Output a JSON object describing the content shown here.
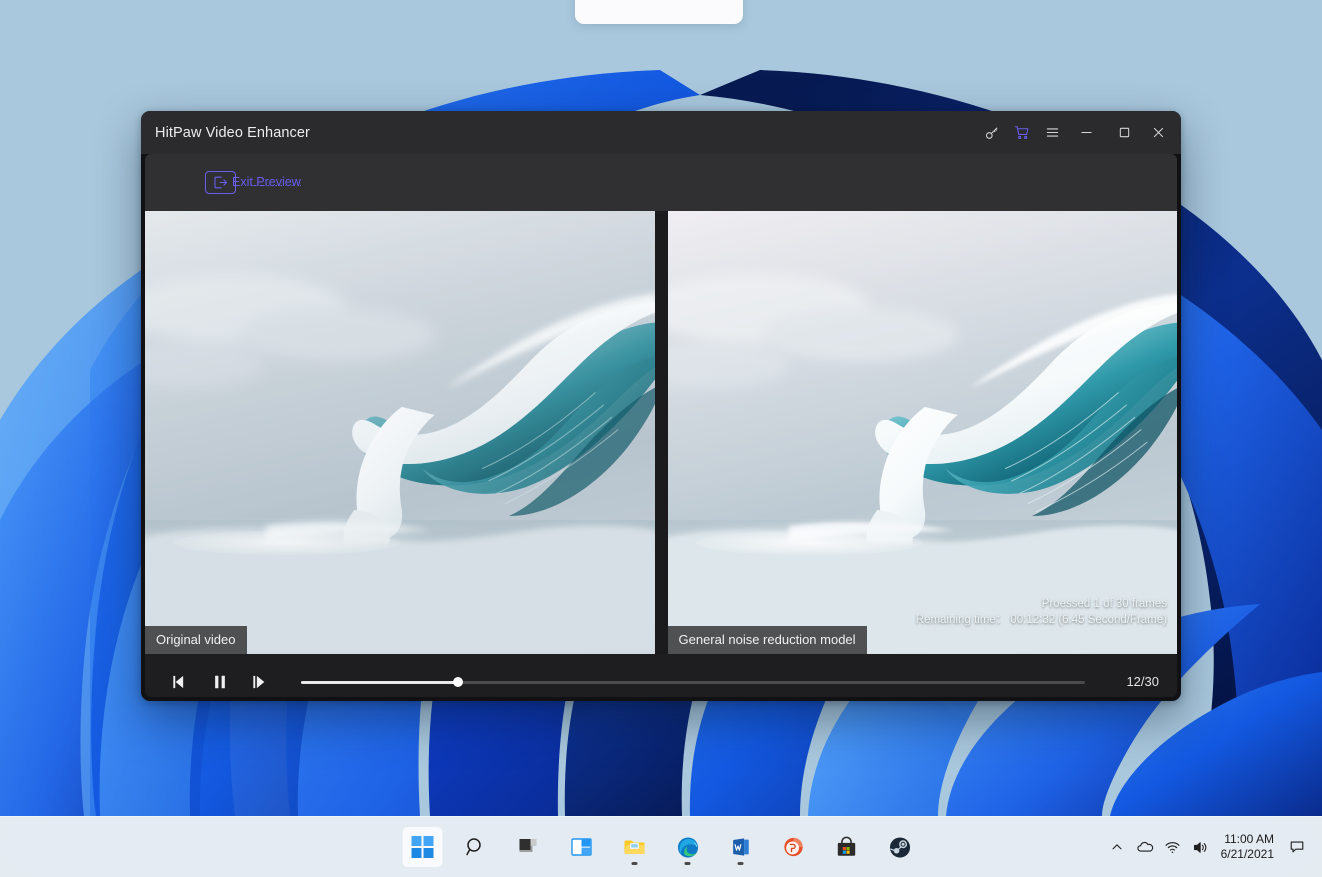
{
  "desktop": {
    "wallpaper_name": "windows-11-bloom-wallpaper",
    "background_color": "#a9c8dd"
  },
  "app": {
    "title": "HitPaw Video Enhancer",
    "titlebar_icons": [
      {
        "name": "key-icon",
        "glyph": "key"
      },
      {
        "name": "shopping-cart-icon",
        "glyph": "cart",
        "color": "#6a5df0"
      },
      {
        "name": "hamburger-menu-icon",
        "glyph": "menu"
      },
      {
        "name": "minimize-icon",
        "glyph": "minimize"
      },
      {
        "name": "maximize-icon",
        "glyph": "maximize"
      },
      {
        "name": "close-icon",
        "glyph": "close"
      }
    ],
    "toolbar": {
      "exit_preview_label": "Exit Preview",
      "accent_color": "#6a5df0"
    },
    "panes": {
      "left": {
        "label": "Original video"
      },
      "right": {
        "label": "General noise reduction model",
        "processed_text": "Proessed 1 of 30 frames",
        "remaining_text": "Remaining time： 00:12:32 (6.45 Second/Frame)"
      }
    },
    "player": {
      "prev_frame_label": "previous-frame",
      "pause_label": "pause",
      "next_frame_label": "next-frame",
      "frame_counter": "12/30",
      "progress_percent": 20
    }
  },
  "taskbar": {
    "items": [
      {
        "name": "start-button",
        "label": "Start",
        "active": true,
        "running": false
      },
      {
        "name": "search-button",
        "label": "Search",
        "active": false,
        "running": false
      },
      {
        "name": "task-view-button",
        "label": "Task View",
        "active": false,
        "running": false
      },
      {
        "name": "widgets-button",
        "label": "Widgets",
        "active": false,
        "running": false
      },
      {
        "name": "file-explorer-button",
        "label": "File Explorer",
        "active": false,
        "running": true
      },
      {
        "name": "edge-button",
        "label": "Microsoft Edge",
        "active": false,
        "running": true
      },
      {
        "name": "word-button",
        "label": "Word",
        "active": false,
        "running": true
      },
      {
        "name": "powerpoint-button",
        "label": "PowerPoint",
        "active": false,
        "running": false
      },
      {
        "name": "microsoft-store-button",
        "label": "Microsoft Store",
        "active": false,
        "running": false
      },
      {
        "name": "steam-button",
        "label": "Steam",
        "active": false,
        "running": false
      }
    ],
    "tray": [
      {
        "name": "show-hidden-icons-button",
        "label": "Show hidden icons"
      },
      {
        "name": "onedrive-icon",
        "label": "OneDrive"
      },
      {
        "name": "wifi-icon",
        "label": "Network"
      },
      {
        "name": "volume-icon",
        "label": "Volume"
      }
    ],
    "clock": {
      "time": "11:00 AM",
      "date": "6/21/2021"
    },
    "notification_label": "Notifications"
  }
}
